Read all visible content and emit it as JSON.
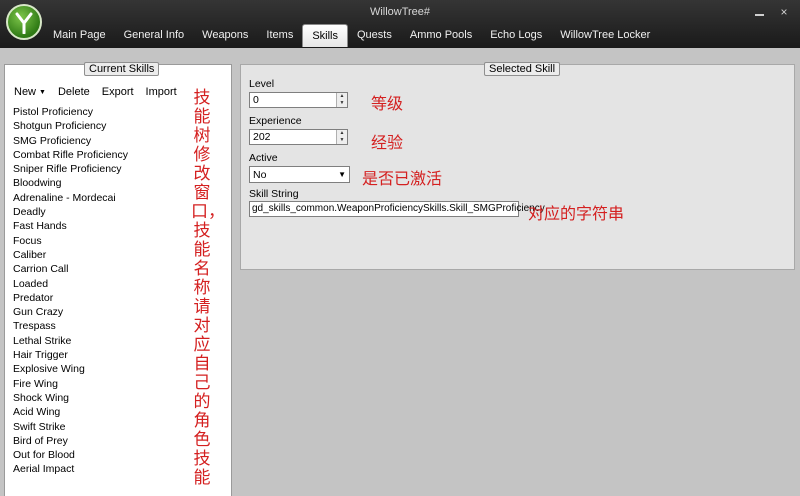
{
  "window": {
    "title": "WillowTree#",
    "controls": {
      "minimize": "—",
      "close": "×"
    }
  },
  "tabs": [
    {
      "label": "Main Page"
    },
    {
      "label": "General Info"
    },
    {
      "label": "Weapons"
    },
    {
      "label": "Items"
    },
    {
      "label": "Skills"
    },
    {
      "label": "Quests"
    },
    {
      "label": "Ammo Pools"
    },
    {
      "label": "Echo Logs"
    },
    {
      "label": "WillowTree Locker"
    }
  ],
  "active_tab": "Skills",
  "current_skills": {
    "header": "Current Skills",
    "toolbar": {
      "new": "New",
      "delete": "Delete",
      "export": "Export",
      "import": "Import"
    },
    "items": [
      "Pistol Proficiency",
      "Shotgun Proficiency",
      "SMG Proficiency",
      "Combat Rifle Proficiency",
      "Sniper Rifle Proficiency",
      "Bloodwing",
      "Adrenaline - Mordecai",
      "Deadly",
      "Fast Hands",
      "Focus",
      "Caliber",
      "Carrion Call",
      "Loaded",
      "Predator",
      "Gun Crazy",
      "Trespass",
      "Lethal Strike",
      "Hair Trigger",
      "Explosive Wing",
      "Fire Wing",
      "Shock Wing",
      "Acid Wing",
      "Swift Strike",
      "Bird of Prey",
      "Out for Blood",
      "Aerial Impact"
    ]
  },
  "selected_skill": {
    "header": "Selected Skill",
    "level": {
      "label": "Level",
      "value": "0"
    },
    "experience": {
      "label": "Experience",
      "value": "202"
    },
    "active": {
      "label": "Active",
      "value": "No"
    },
    "skill_string": {
      "label": "Skill String",
      "value": "gd_skills_common.WeaponProficiencySkills.Skill_SMGProficiency"
    }
  },
  "annotations": {
    "level": "等级",
    "experience": "经验",
    "active": "是否已激活",
    "skill_string": "对应的字符串",
    "vertical": "技能树修改窗口，技能名称请对应自己的角色技能"
  },
  "colors": {
    "title_bar": "#1a1a1a",
    "content_bg": "#c4c4c4",
    "annotation_red": "#d42020",
    "logo_green": "#4a9a22"
  }
}
